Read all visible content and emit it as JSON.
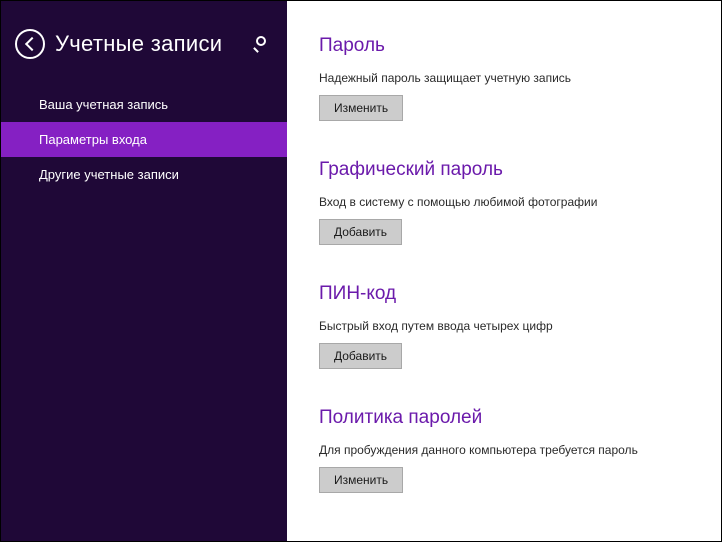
{
  "sidebar": {
    "title": "Учетные записи",
    "items": [
      {
        "label": "Ваша учетная запись",
        "active": false
      },
      {
        "label": "Параметры входа",
        "active": true
      },
      {
        "label": "Другие учетные записи",
        "active": false
      }
    ]
  },
  "sections": {
    "password": {
      "title": "Пароль",
      "desc": "Надежный пароль защищает учетную запись",
      "button": "Изменить"
    },
    "picture_password": {
      "title": "Графический пароль",
      "desc": "Вход в систему с помощью любимой фотографии",
      "button": "Добавить"
    },
    "pin": {
      "title": "ПИН-код",
      "desc": "Быстрый вход путем ввода четырех цифр",
      "button": "Добавить"
    },
    "policy": {
      "title": "Политика паролей",
      "desc": "Для пробуждения данного компьютера требуется пароль",
      "button": "Изменить"
    }
  },
  "colors": {
    "sidebar_bg": "#1f0837",
    "accent": "#8520c3",
    "heading": "#6b1aab",
    "button_bg": "#cccccc"
  }
}
